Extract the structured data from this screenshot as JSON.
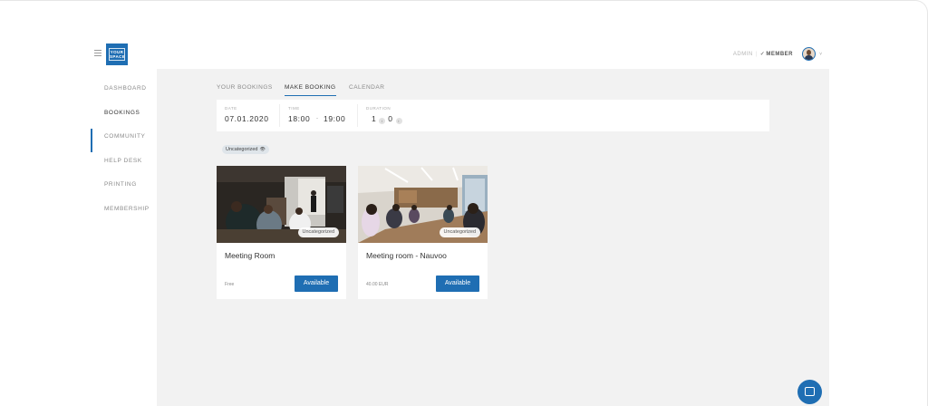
{
  "brand": {
    "logo_line1": "YOUR",
    "logo_line2": "SPACE"
  },
  "header": {
    "admin_label": "ADMIN",
    "separator": "|",
    "member_label": "MEMBER",
    "member_check": "✓",
    "avatar_caret": "˅"
  },
  "sidebar": {
    "items": [
      {
        "label": "DASHBOARD"
      },
      {
        "label": "BOOKINGS"
      },
      {
        "label": "COMMUNITY"
      },
      {
        "label": "HELP DESK"
      },
      {
        "label": "PRINTING"
      },
      {
        "label": "MEMBERSHIP"
      }
    ],
    "active_index": 1
  },
  "tabs": [
    {
      "label": "YOUR BOOKINGS"
    },
    {
      "label": "MAKE BOOKING"
    },
    {
      "label": "CALENDAR"
    }
  ],
  "active_tab": 1,
  "filter": {
    "date_label": "DATE",
    "date_value": "07.01.2020",
    "time_label": "TIME",
    "time_start": "18:00",
    "time_dash": "-",
    "time_end": "19:00",
    "duration_label": "DURATION",
    "duration_hours": "1",
    "duration_minutes": "0",
    "stepper_glyph": "↕"
  },
  "category_chip": {
    "label": "Uncategorized",
    "icon": "👁"
  },
  "cards": [
    {
      "title": "Meeting Room",
      "badge": "Uncategorized",
      "price": "Free",
      "button": "Available"
    },
    {
      "title": "Meeting room - Nauvoo",
      "badge": "Uncategorized",
      "price": "40.00 EUR",
      "button": "Available"
    }
  ],
  "colors": {
    "accent": "#1f6eb3",
    "background": "#f2f2f2"
  }
}
